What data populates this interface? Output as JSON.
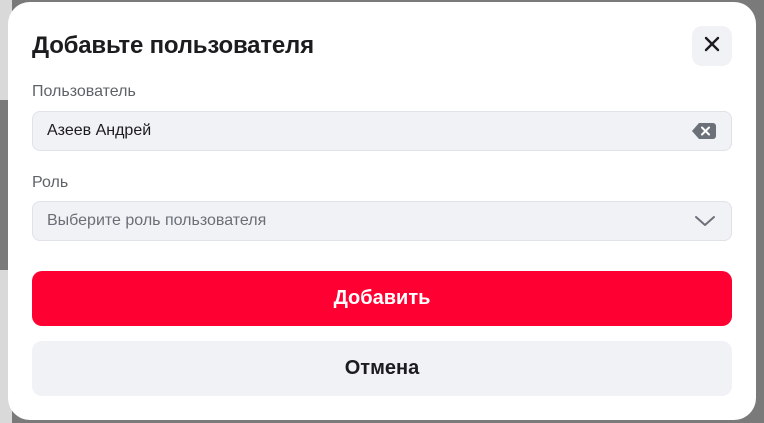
{
  "modal": {
    "title": "Добавьте пользователя",
    "close_icon": "close-icon"
  },
  "user_field": {
    "label": "Пользователь",
    "value": "Азеев Андрей",
    "clear_icon": "clear-icon"
  },
  "role_field": {
    "label": "Роль",
    "placeholder": "Выберите роль пользователя",
    "chevron_icon": "chevron-down-icon"
  },
  "actions": {
    "add_label": "Добавить",
    "cancel_label": "Отмена"
  },
  "colors": {
    "accent": "#ff0032",
    "secondary_bg": "#f1f2f5",
    "field_bg": "#f1f2f6",
    "title_text": "#1c1c1e",
    "label_text": "#5f6368"
  }
}
